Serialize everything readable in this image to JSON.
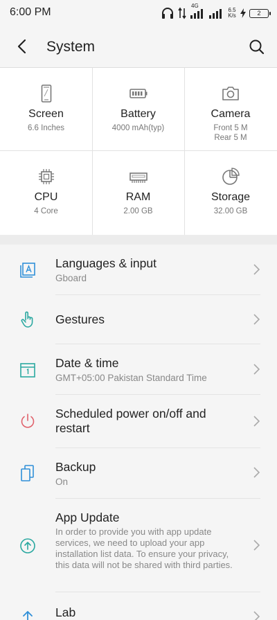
{
  "status_bar": {
    "time": "6:00 PM",
    "network_type": "4G",
    "net_speed_value": "6.5",
    "net_speed_unit": "K/s",
    "battery_level": "2"
  },
  "header": {
    "title": "System",
    "back_icon": "back-arrow-icon",
    "search_icon": "search-icon"
  },
  "specs": [
    {
      "title": "Screen",
      "value": "6.6 Inches",
      "icon": "phone-icon"
    },
    {
      "title": "Battery",
      "value": "4000 mAh(typ)",
      "icon": "battery-icon"
    },
    {
      "title": "Camera",
      "value": "Front 5 M",
      "value2": "Rear 5 M",
      "icon": "camera-icon"
    },
    {
      "title": "CPU",
      "value": "4 Core",
      "icon": "chip-icon"
    },
    {
      "title": "RAM",
      "value": "2.00 GB",
      "icon": "ram-icon"
    },
    {
      "title": "Storage",
      "value": "32.00 GB",
      "icon": "pie-chart-icon"
    }
  ],
  "settings": [
    {
      "title": "Languages & input",
      "subtitle": "Gboard",
      "icon": "language-icon"
    },
    {
      "title": "Gestures",
      "icon": "gesture-hand-icon"
    },
    {
      "title": "Date & time",
      "subtitle": "GMT+05:00 Pakistan Standard Time",
      "icon": "calendar-icon"
    },
    {
      "title": "Scheduled power on/off and restart",
      "icon": "power-icon"
    },
    {
      "title": "Backup",
      "subtitle": "On",
      "icon": "backup-icon"
    },
    {
      "title": "App Update",
      "subtitle": "In order to provide you with app update services, we need to upload your app installation list data. To ensure your privacy, this data will not be shared with third parties.",
      "icon": "update-arrow-icon"
    },
    {
      "title": "Lab",
      "icon": "lab-arrow-icon"
    }
  ],
  "colors": {
    "teal": "#2aa8a0",
    "blue": "#2f8fd8",
    "red": "#e0606a",
    "icon_gray": "#777777"
  }
}
